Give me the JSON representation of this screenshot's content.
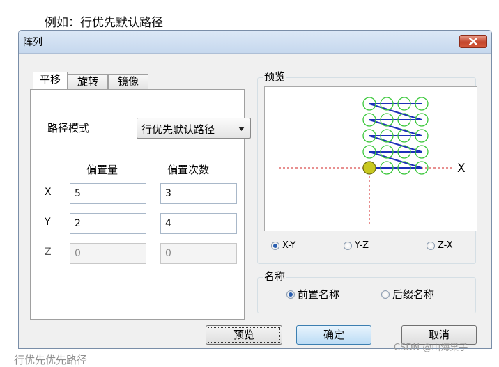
{
  "doc": {
    "caption_top": "例如：行优先默认路径",
    "caption_bottom": "行优先优先路径",
    "watermark": "CSDN @山海果子"
  },
  "window": {
    "title": "阵列",
    "close_icon": "close-x-icon"
  },
  "tabs": [
    {
      "label": "平移",
      "active": true
    },
    {
      "label": "旋转",
      "active": false
    },
    {
      "label": "镜像",
      "active": false
    }
  ],
  "translate": {
    "path_mode_label": "路径模式",
    "path_mode_value": "行优先默认路径",
    "offset_header": "偏置量",
    "count_header": "偏置次数",
    "rows": [
      {
        "axis": "X",
        "offset": "5",
        "count": "3",
        "enabled": true
      },
      {
        "axis": "Y",
        "offset": "2",
        "count": "4",
        "enabled": true
      },
      {
        "axis": "Z",
        "offset": "0",
        "count": "0",
        "enabled": false
      }
    ]
  },
  "preview": {
    "group_title": "预览",
    "axis_label": "X",
    "grid": {
      "cols": 4,
      "rows": 5,
      "origin_color": "#c8c820",
      "node_color": "#3cc83c",
      "path_color": "#1c2fb8",
      "guide_color": "#d02020"
    },
    "planes": [
      {
        "label": "X-Y",
        "checked": true
      },
      {
        "label": "Y-Z",
        "checked": false
      },
      {
        "label": "Z-X",
        "checked": false
      }
    ]
  },
  "naming": {
    "group_title": "名称",
    "options": [
      {
        "label": "前置名称",
        "checked": true
      },
      {
        "label": "后缀名称",
        "checked": false
      }
    ]
  },
  "buttons": {
    "preview": "预览",
    "ok": "确定",
    "cancel": "取消"
  }
}
